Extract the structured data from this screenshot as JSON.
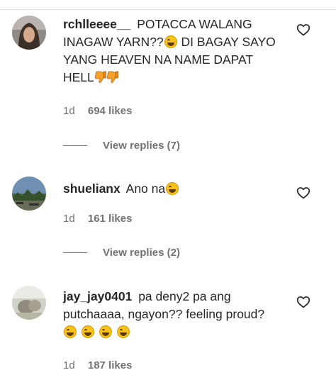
{
  "comments": [
    {
      "username": "rchlleeee__",
      "text_parts": [
        "POTACCA WALANG INAGAW YARN??",
        " DI BAGAY SAYO YANG HEAVEN NA NAME DAPAT HELL"
      ],
      "time": "1d",
      "likes": "694 likes",
      "replies": "View replies (7)"
    },
    {
      "username": "shuelianx",
      "text_parts": [
        "Ano na"
      ],
      "time": "1d",
      "likes": "161 likes",
      "replies": "View replies (2)"
    },
    {
      "username": "jay_jay0401",
      "text_parts": [
        "pa deny2 pa ang putchaaaa, ngayon?? feeling proud?"
      ],
      "time": "1d",
      "likes": "187 likes"
    }
  ],
  "icons": {
    "like": "heart-outline-icon",
    "emoji_laugh": "face-with-tears-of-joy",
    "emoji_thumbs_down": "thumbs-down"
  },
  "colors": {
    "text": "#262626",
    "muted": "#737373",
    "divider": "#dbdbdb"
  }
}
